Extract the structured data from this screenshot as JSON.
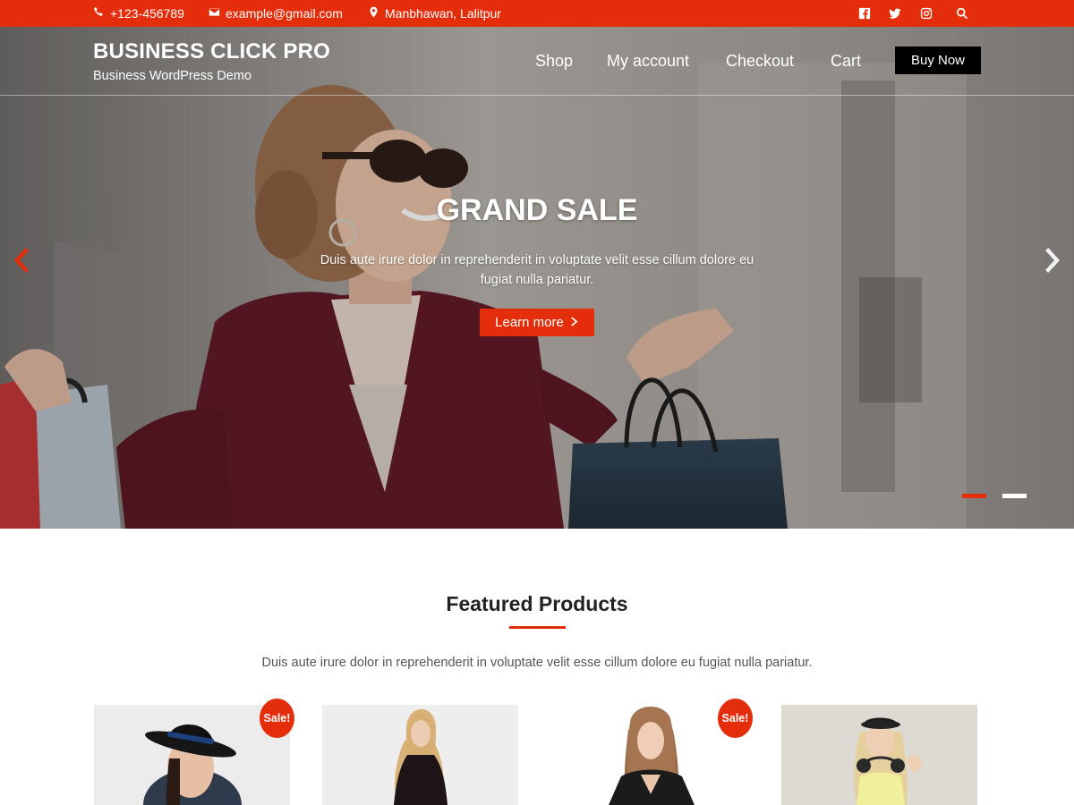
{
  "colors": {
    "accent": "#e32d0b",
    "buy_button": "#000000"
  },
  "topbar": {
    "phone": "+123-456789",
    "email": "example@gmail.com",
    "address": "Manbhawan, Lalitpur",
    "icons": [
      "phone-icon",
      "envelope-icon",
      "map-marker-icon",
      "facebook-icon",
      "twitter-icon",
      "instagram-icon",
      "search-icon"
    ]
  },
  "header": {
    "site_title": "BUSINESS CLICK PRO",
    "tagline": "Business WordPress Demo",
    "nav": [
      "Shop",
      "My account",
      "Checkout",
      "Cart"
    ],
    "buy_now": "Buy Now"
  },
  "hero": {
    "title": "GRAND SALE",
    "description": "Duis aute irure dolor in reprehenderit in voluptate velit esse cillum dolore eu fugiat nulla pariatur.",
    "button": "Learn more",
    "slides_total": 2,
    "active_slide": 1
  },
  "featured": {
    "title": "Featured Products",
    "description": "Duis aute irure dolor in reprehenderit in voluptate velit esse cillum dolore eu fugiat nulla pariatur.",
    "products": [
      {
        "badge": "Sale!"
      },
      {
        "badge": ""
      },
      {
        "badge": "Sale!"
      },
      {
        "badge": ""
      }
    ]
  }
}
